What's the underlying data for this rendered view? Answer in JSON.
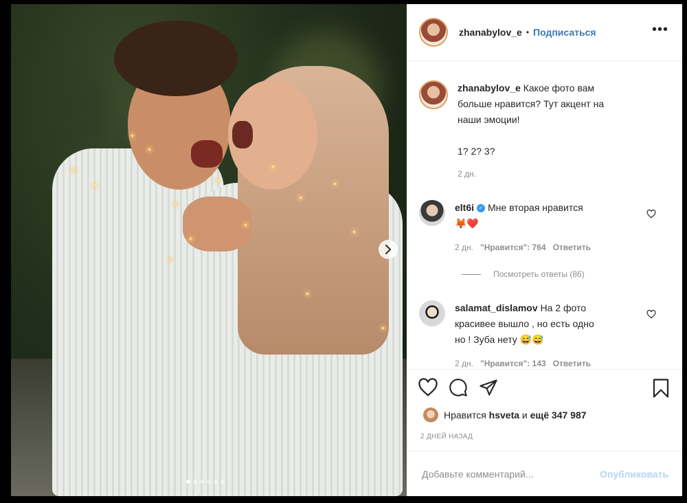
{
  "post": {
    "author": "zhanabylov_e",
    "follow_label": "Подписаться",
    "more_label": "•••",
    "caption": {
      "line1": "Какое фото вам",
      "line2": "больше нравится? Тут акцент на",
      "line3": "наши эмоции!",
      "line4": "1? 2? 3?",
      "time": "2 дн."
    },
    "comments": [
      {
        "user": "elt6i",
        "text": "Мне вторая нравится",
        "emoji": "🦊❤️",
        "time": "2 дн.",
        "likes": "\"Нравится\": 764",
        "reply": "Ответить",
        "view_replies": "Посмотреть ответы (86)"
      },
      {
        "user": "salamat_dislamov",
        "text": "На 2 фото",
        "text2": "красивее вышло , но есть одно",
        "text3": "но ! Зуба нету 😅😅",
        "time": "2 дн.",
        "likes": "\"Нравится\": 143",
        "reply": "Ответить"
      }
    ],
    "likes_prefix": "Нравится",
    "likes_user": "hsveta",
    "likes_mid": "и",
    "likes_count": "ещё 347 987",
    "date": "2 ДНЕЙ НАЗАД",
    "comment_placeholder": "Добавьте комментарий...",
    "publish_label": "Опубликовать",
    "carousel": {
      "slides": 6,
      "active": 1
    }
  },
  "colors": {
    "link": "#3a79b8",
    "muted": "#8e8e8e",
    "text": "#262626",
    "publish_disabled": "#b7d5f5"
  },
  "icons": [
    "chevron-right-icon",
    "heart-icon",
    "comment-icon",
    "share-icon",
    "bookmark-icon",
    "more-icon",
    "verified-icon"
  ]
}
